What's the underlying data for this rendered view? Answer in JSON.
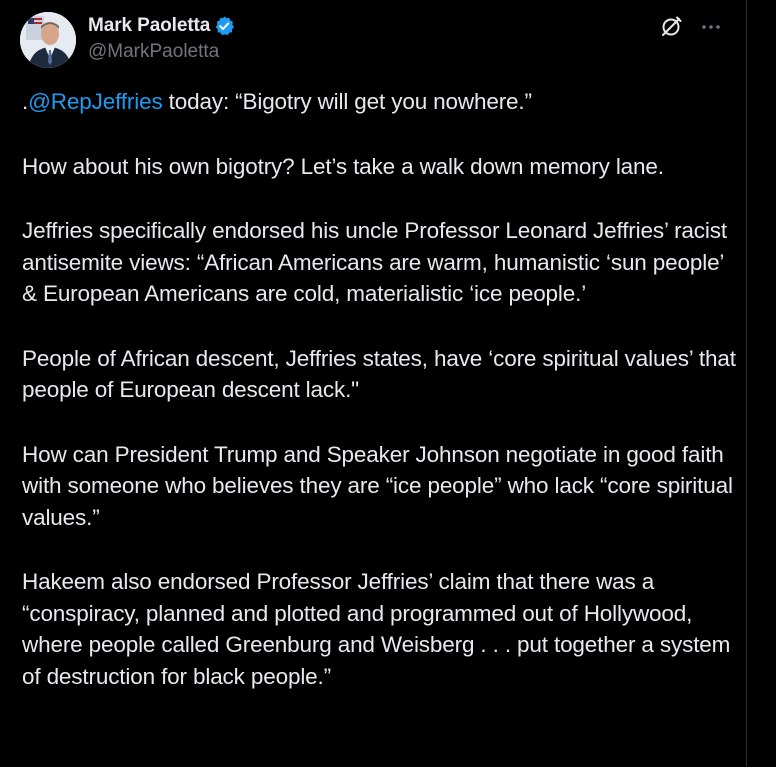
{
  "author": {
    "display_name": "Mark Paoletta",
    "handle": "@MarkPaoletta",
    "verified": true,
    "avatar_icon": "profile-photo"
  },
  "actions": {
    "grok_icon": "grok-icon",
    "more_icon": "more-options-icon"
  },
  "tweet": {
    "p1_prefix": ".",
    "p1_mention": "@RepJeffries",
    "p1_rest": " today: “Bigotry will get you nowhere.”",
    "p2": "How about his own bigotry? Let’s take a walk down memory lane.",
    "p3": "Jeffries specifically endorsed his uncle Professor Leonard Jeffries’ racist antisemite views: “African Americans are warm, humanistic ‘sun people’ & European Americans are cold, materialistic ‘ice people.’",
    "p4": "People of African descent, Jeffries states, have ‘core spiritual values’ that people of European descent lack.\"",
    "p5": "How can President Trump and Speaker Johnson negotiate in good faith with someone who believes they are “ice people” who lack “core spiritual values.”",
    "p6": "Hakeem also endorsed Professor Jeffries’ claim that there was a “conspiracy, planned and plotted and programmed out of Hollywood, where people called Greenburg and Weisberg . . . put together a system of destruction for black people.”"
  },
  "colors": {
    "background": "#000000",
    "text": "#e7e9ea",
    "secondary": "#71767b",
    "link": "#1d9bf0",
    "verified": "#1d9bf0"
  }
}
